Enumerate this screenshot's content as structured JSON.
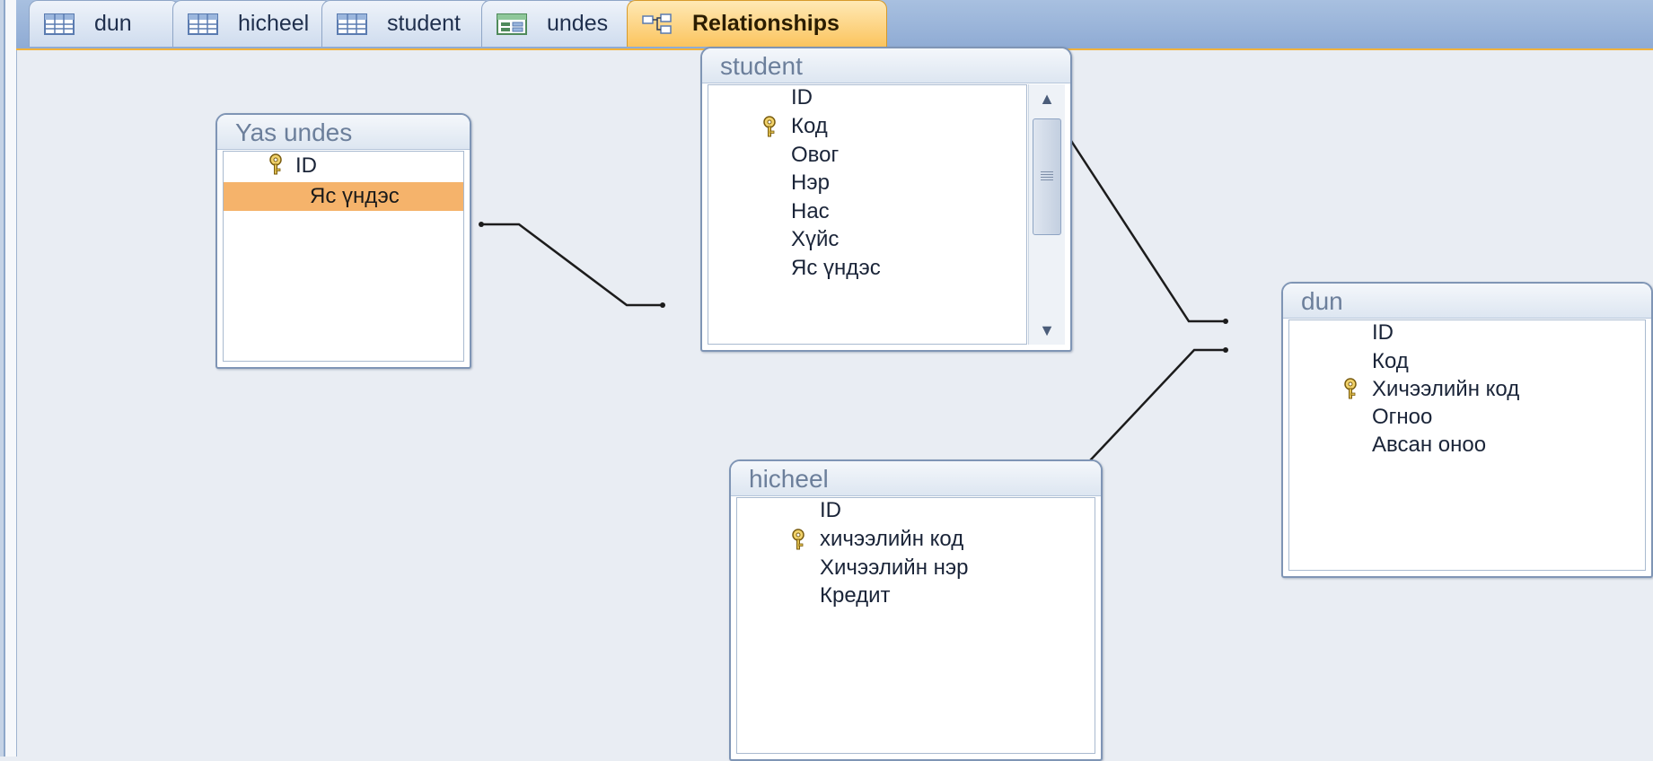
{
  "tabs": [
    {
      "label": "dun",
      "icon": "table-icon"
    },
    {
      "label": "hicheel",
      "icon": "table-icon"
    },
    {
      "label": "student",
      "icon": "table-icon"
    },
    {
      "label": "undes",
      "icon": "form-icon"
    },
    {
      "label": "Relationships",
      "icon": "relationships-icon",
      "active": true
    }
  ],
  "tables": {
    "yas_undes": {
      "title": "Yas undes",
      "fields": [
        "ID",
        "Яс үндэс"
      ],
      "primary_key": "ID",
      "selected": "Яс үндэс"
    },
    "student": {
      "title": "student",
      "fields": [
        "ID",
        "Код",
        "Овог",
        "Нэр",
        "Нас",
        "Хүйс",
        "Яс үндэс"
      ],
      "primary_key": "Код"
    },
    "hicheel": {
      "title": "hicheel",
      "fields": [
        "ID",
        "хичээлийн код",
        "Хичээлийн нэр",
        "Кредит"
      ],
      "primary_key": "хичээлийн код"
    },
    "dun": {
      "title": "dun",
      "fields": [
        "ID",
        "Код",
        "Хичээлийн код",
        "Огноо",
        "Авсан оноо"
      ],
      "primary_key": "Хичээлийн код"
    }
  },
  "relationships": [
    {
      "from": "Yas undes.Яс үндэс",
      "to": "student.Яс үндэс"
    },
    {
      "from": "student.Код",
      "to": "dun.Код"
    },
    {
      "from": "hicheel.хичээлийн код",
      "to": "dun.Хичээлийн код"
    }
  ],
  "colors": {
    "selected_field": "#f5b36b",
    "active_tab": "#fbc45e",
    "canvas": "#e9edf3"
  }
}
